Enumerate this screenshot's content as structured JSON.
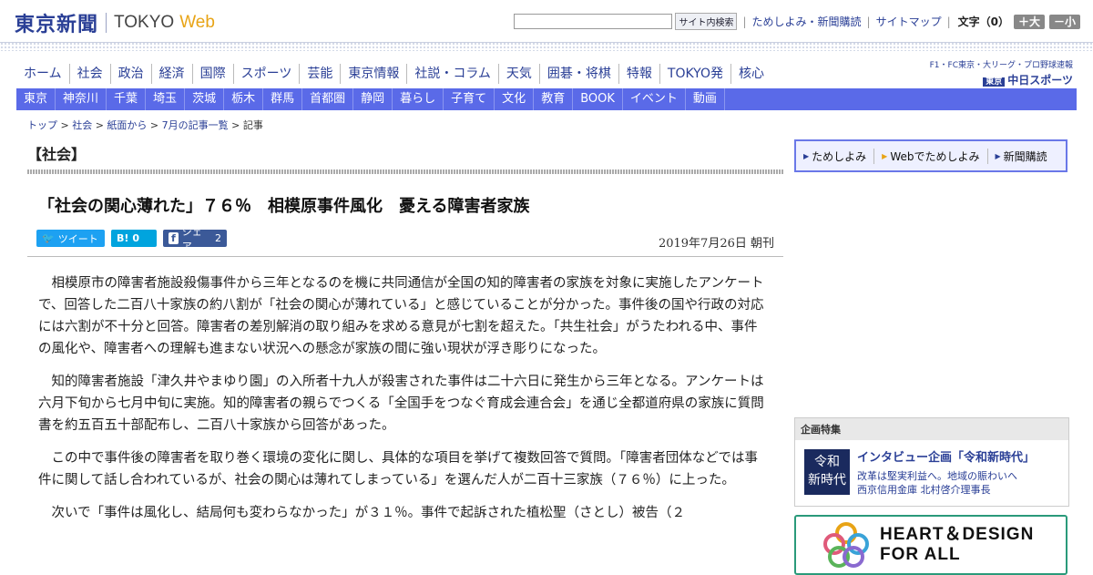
{
  "header": {
    "logo_jp": "東京新聞",
    "logo_en": "TOKYO",
    "logo_web": "Web",
    "search_placeholder": "",
    "search_button": "サイト内検索",
    "links": [
      "ためしよみ・新聞購読",
      "サイトマップ"
    ],
    "font_label": "文字（0）",
    "size_up": "＋大",
    "size_down": "－小"
  },
  "nav_main": [
    "ホーム",
    "社会",
    "政治",
    "経済",
    "国際",
    "スポーツ",
    "芸能",
    "東京情報",
    "社説・コラム",
    "天気",
    "囲碁・将棋",
    "特報",
    "TOKYO発",
    "核心"
  ],
  "chunichi": {
    "top": "F1・FC東京・大リーグ・プロ野球速報",
    "badge": "東京",
    "name": "中日スポーツ"
  },
  "nav_region": [
    "東京",
    "神奈川",
    "千葉",
    "埼玉",
    "茨城",
    "栃木",
    "群馬",
    "首都圏",
    "静岡",
    "暮らし",
    "子育て",
    "文化",
    "教育",
    "BOOK",
    "イベント",
    "動画"
  ],
  "breadcrumb": {
    "items": [
      "トップ",
      "社会",
      "紙面から",
      "7月の記事一覧"
    ],
    "current": "記事"
  },
  "section_title": "【社会】",
  "article": {
    "headline": "「社会の関心薄れた」７６％　相模原事件風化　憂える障害者家族",
    "date": "2019年7月26日 朝刊",
    "paragraphs": [
      "相模原市の障害者施設殺傷事件から三年となるのを機に共同通信が全国の知的障害者の家族を対象に実施したアンケートで、回答した二百八十家族の約八割が「社会の関心が薄れている」と感じていることが分かった。事件後の国や行政の対応には六割が不十分と回答。障害者の差別解消の取り組みを求める意見が七割を超えた。「共生社会」がうたわれる中、事件の風化や、障害者への理解も進まない状況への懸念が家族の間に強い現状が浮き彫りになった。",
      "知的障害者施設「津久井やまゆり園」の入所者十九人が殺害された事件は二十六日に発生から三年となる。アンケートは六月下旬から七月中旬に実施。知的障害者の親らでつくる「全国手をつなぐ育成会連合会」を通じ全都道府県の家族に質問書を約五百五十部配布し、二百八十家族から回答があった。",
      "この中で事件後の障害者を取り巻く環境の変化に関し、具体的な項目を挙げて複数回答で質問。「障害者団体などでは事件に関して話し合われているが、社会の関心は薄れてしまっている」を選んだ人が二百十三家族（７６％）に上った。",
      "次いで「事件は風化し、結局何も変わらなかった」が３１％。事件で起訴された植松聖（さとし）被告（２"
    ]
  },
  "share": {
    "tweet": "ツイート",
    "hatena": "B!",
    "hatena_count": "0",
    "fb": "シェア",
    "fb_count": "2"
  },
  "promo": [
    "ためしよみ",
    "Webでためしよみ",
    "新聞購読"
  ],
  "feature": {
    "heading": "企画特集",
    "image_text_1": "令和",
    "image_text_2": "新時代",
    "title": "インタビュー企画「令和新時代」",
    "sub1": "改革は堅実利益へ。地域の賑わいへ",
    "sub2": "西京信用金庫 北村啓介理事長"
  },
  "banner": {
    "line1": "HEART＆DESIGN",
    "line2": "FOR ALL"
  },
  "colors": {
    "brand": "#2a3f96",
    "nav_bar": "#5a6ae8",
    "accent": "#e8a416"
  }
}
